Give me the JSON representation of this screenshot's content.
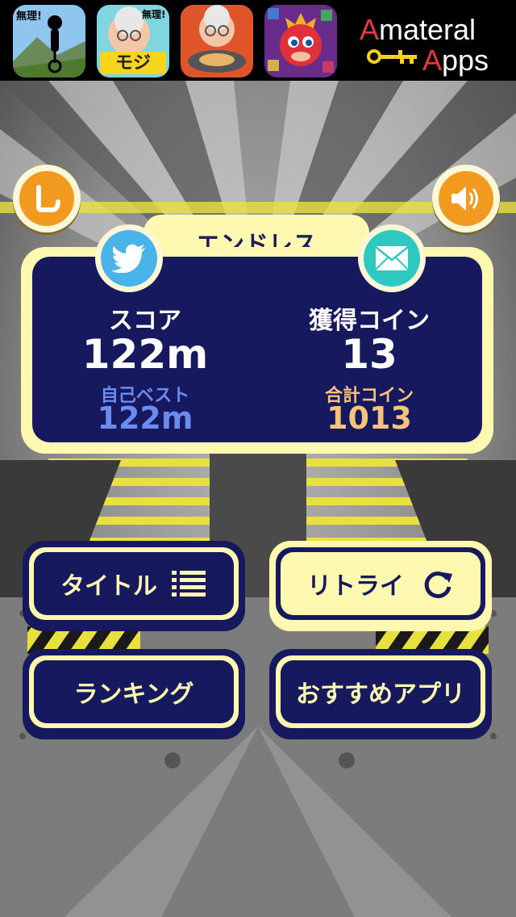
{
  "ad_bar": {
    "brand_part1": "A",
    "brand_part1_rest": "materal",
    "brand_part2": "A",
    "brand_part2_rest": "pps",
    "app_icons": [
      {
        "name": "unicycle-game-icon",
        "badge": "無理!"
      },
      {
        "name": "grandma-moji-game-icon",
        "badge": "無理!",
        "label": "モジ"
      },
      {
        "name": "grandma-cooking-game-icon"
      },
      {
        "name": "dragon-puzzle-game-icon"
      }
    ]
  },
  "result": {
    "mode_title": "エンドレス",
    "score_label": "スコア",
    "score_value": "122m",
    "best_label": "自己ベスト",
    "best_value": "122m",
    "coins_label": "獲得コイン",
    "coins_value": "13",
    "total_coins_label": "合計コイン",
    "total_coins_value": "1013"
  },
  "buttons": {
    "title": "タイトル",
    "retry": "リトライ",
    "ranking": "ランキング",
    "recommended": "おすすめアプリ"
  },
  "icons": {
    "review": "review-icon",
    "sound": "speaker-icon",
    "twitter": "twitter-icon",
    "mail": "mail-icon",
    "list": "list-icon",
    "refresh": "refresh-icon"
  },
  "colors": {
    "navy": "#16195e",
    "cream": "#fff8b0",
    "orange": "#f29a1f",
    "best_blue": "#6a8cf0",
    "total_gold": "#f5c47a",
    "stripe_yellow": "#e8e040"
  }
}
